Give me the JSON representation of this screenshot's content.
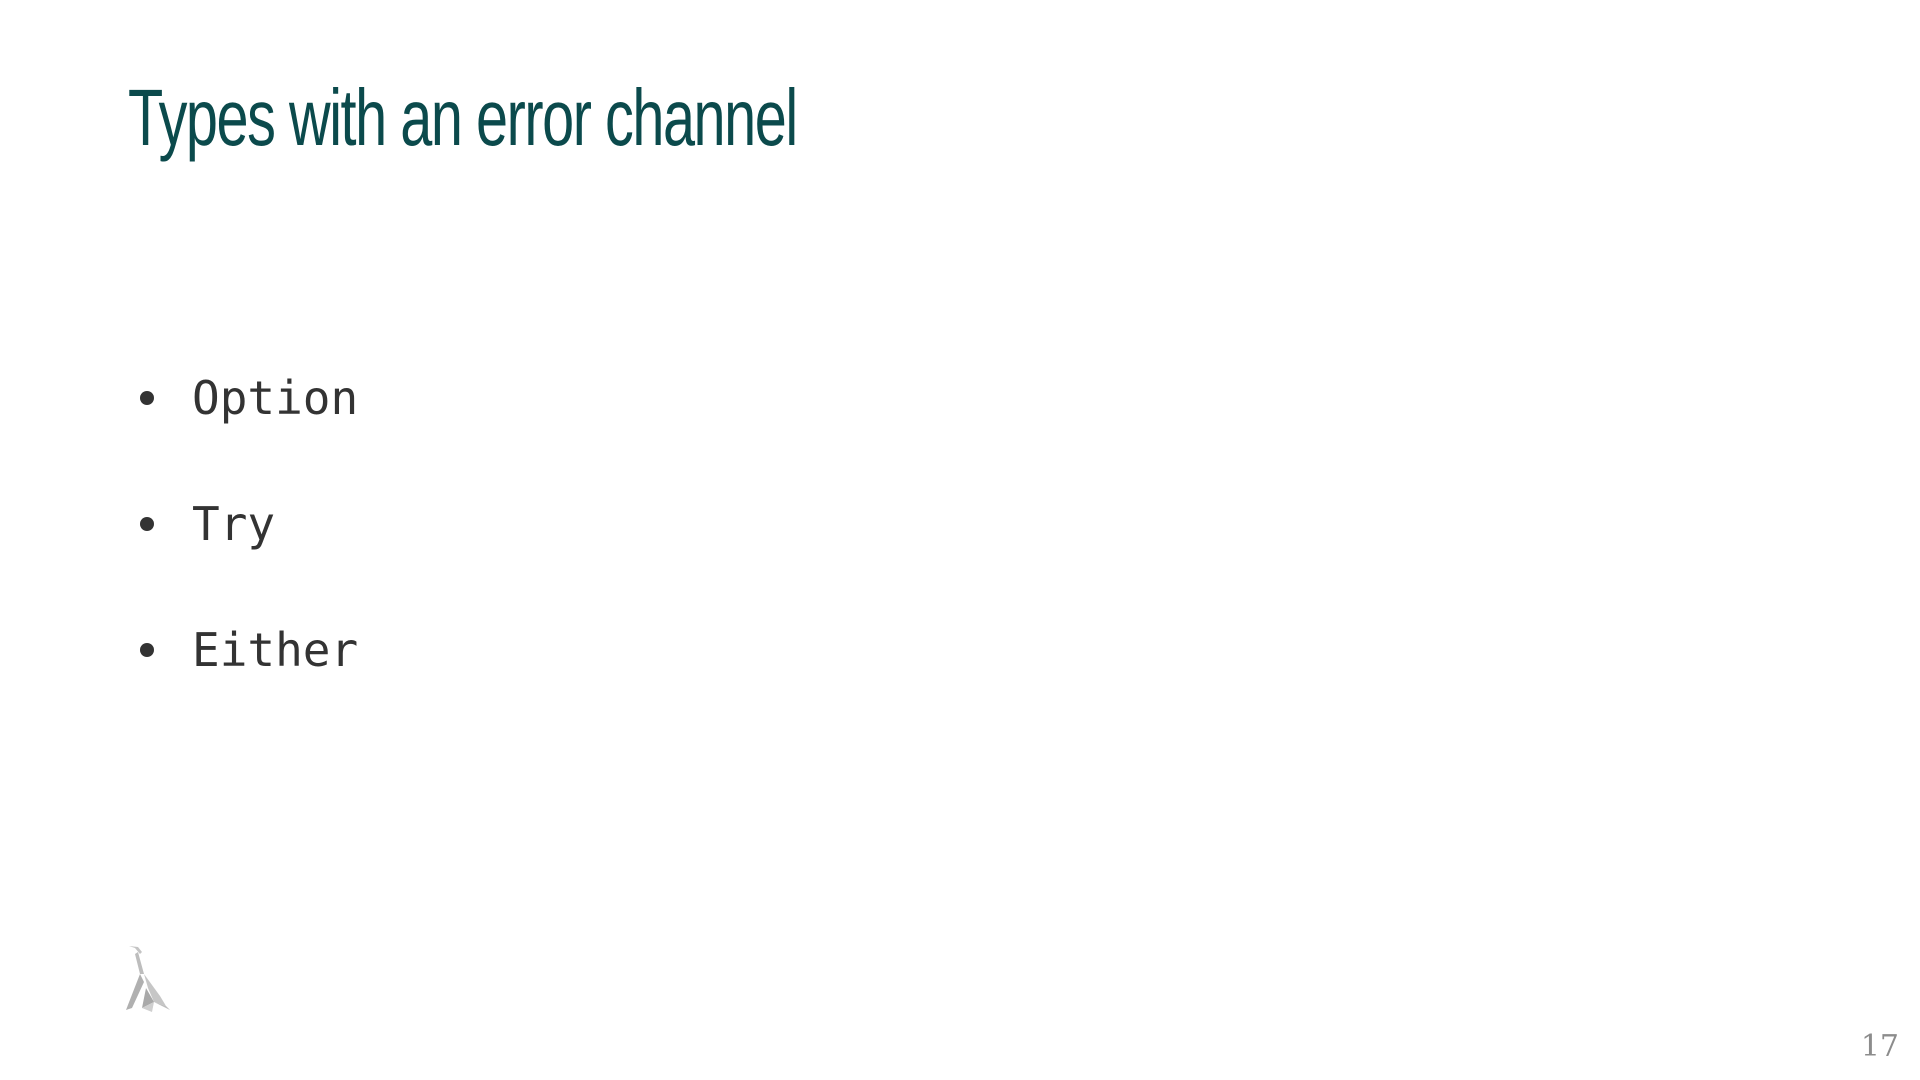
{
  "slide": {
    "title": "Types with an error channel",
    "bullets": [
      {
        "text": "Option"
      },
      {
        "text": "Try"
      },
      {
        "text": "Either"
      }
    ],
    "logo_icon": "lambda-logo-icon",
    "page_number": "17"
  },
  "colors": {
    "title": "#0b4a4c",
    "text": "#333333",
    "page_number": "#8c8c8c",
    "logo": "#b8b8b8"
  }
}
